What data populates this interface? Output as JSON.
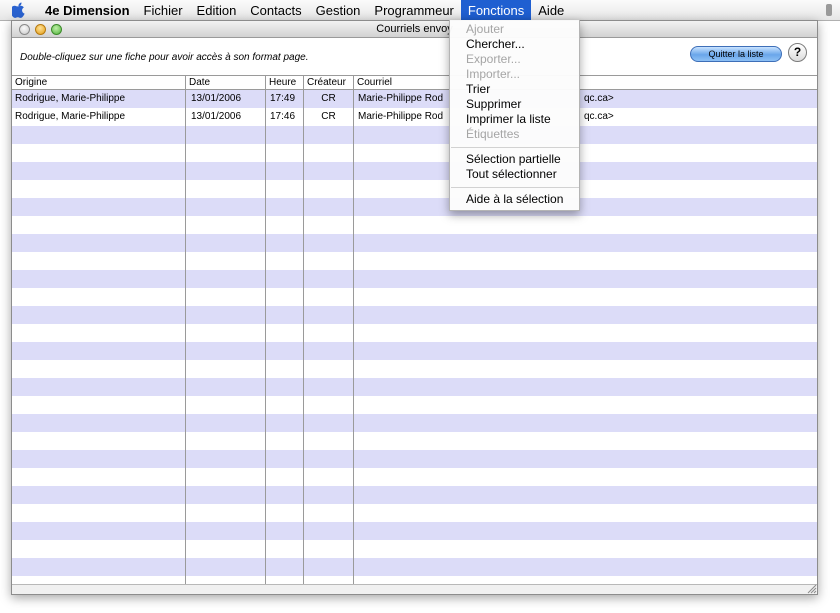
{
  "menubar": {
    "apple_icon": "apple-logo-icon",
    "items": [
      {
        "label": "4e Dimension",
        "bold": true
      },
      {
        "label": "Fichier"
      },
      {
        "label": "Edition"
      },
      {
        "label": "Contacts"
      },
      {
        "label": "Gestion"
      },
      {
        "label": "Programmeur"
      },
      {
        "label": "Fonctions",
        "active": true
      },
      {
        "label": "Aide"
      }
    ]
  },
  "window": {
    "title": "Courriels envoy",
    "hint": "Double-cliquez sur une fiche pour avoir accès à son format page.",
    "quit_label": "Quitter la liste",
    "help_label": "?"
  },
  "table": {
    "columns": [
      "Origine",
      "Date",
      "Heure",
      "Créateur",
      "Courriel"
    ],
    "rows": [
      {
        "origine": "Rodrigue, Marie-Philippe",
        "date": "13/01/2006",
        "heure": "17:49",
        "createur": "CR",
        "courriel_start": "Marie-Philippe Rod",
        "courriel_end": "qc.ca>"
      },
      {
        "origine": "Rodrigue, Marie-Philippe",
        "date": "13/01/2006",
        "heure": "17:46",
        "createur": "CR",
        "courriel_start": "Marie-Philippe Rod",
        "courriel_end": "qc.ca>"
      }
    ]
  },
  "dropdown": {
    "items": [
      {
        "label": "Ajouter",
        "enabled": false
      },
      {
        "label": "Chercher...",
        "enabled": true
      },
      {
        "label": "Exporter...",
        "enabled": false
      },
      {
        "label": "Importer...",
        "enabled": false
      },
      {
        "label": "Trier",
        "enabled": true
      },
      {
        "label": "Supprimer",
        "enabled": true
      },
      {
        "label": "Imprimer la liste",
        "enabled": true
      },
      {
        "label": "Étiquettes",
        "enabled": false
      },
      {
        "label": "Sélection partielle",
        "enabled": true
      },
      {
        "label": "Tout sélectionner",
        "enabled": true
      },
      {
        "label": "Aide à la sélection",
        "enabled": true
      }
    ]
  },
  "colors": {
    "row_stripe": "#dcdcf8",
    "menu_highlight": "#1f5fd1",
    "quit_button": "#6aa6ea"
  }
}
